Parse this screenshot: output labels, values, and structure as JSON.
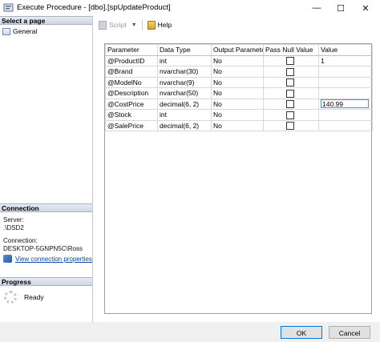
{
  "window": {
    "title": "Execute Procedure - [dbo].[spUpdateProduct]",
    "controls": {
      "minimize": "—",
      "maximize": "☐",
      "close": "✕"
    }
  },
  "left_pane": {
    "select_page_header": "Select a page",
    "pages": [
      {
        "label": "General",
        "icon": "general-page-icon"
      }
    ],
    "connection_header": "Connection",
    "server_label": "Server:",
    "server_value": ".\\DSD2",
    "connection_label": "Connection:",
    "connection_value": "DESKTOP-5GNPN5C\\Ross",
    "view_connection_link": "View connection properties",
    "progress_header": "Progress",
    "progress_status": "Ready"
  },
  "toolbar": {
    "script_label": "Script",
    "help_label": "Help"
  },
  "grid": {
    "columns": [
      "Parameter",
      "Data Type",
      "Output Parameter",
      "Pass Null Value",
      "Value"
    ],
    "rows": [
      {
        "parameter": "@ProductID",
        "data_type": "int",
        "output": "No",
        "pass_null": false,
        "value": "1"
      },
      {
        "parameter": "@Brand",
        "data_type": "nvarchar(30)",
        "output": "No",
        "pass_null": false,
        "value": ""
      },
      {
        "parameter": "@ModelNo",
        "data_type": "nvarchar(9)",
        "output": "No",
        "pass_null": false,
        "value": ""
      },
      {
        "parameter": "@Description",
        "data_type": "nvarchar(50)",
        "output": "No",
        "pass_null": false,
        "value": ""
      },
      {
        "parameter": "@CostPrice",
        "data_type": "decimal(6, 2)",
        "output": "No",
        "pass_null": false,
        "value": "140.99"
      },
      {
        "parameter": "@Stock",
        "data_type": "int",
        "output": "No",
        "pass_null": false,
        "value": ""
      },
      {
        "parameter": "@SalePrice",
        "data_type": "decimal(6, 2)",
        "output": "No",
        "pass_null": false,
        "value": ""
      }
    ]
  },
  "footer": {
    "ok_label": "OK",
    "cancel_label": "Cancel"
  }
}
